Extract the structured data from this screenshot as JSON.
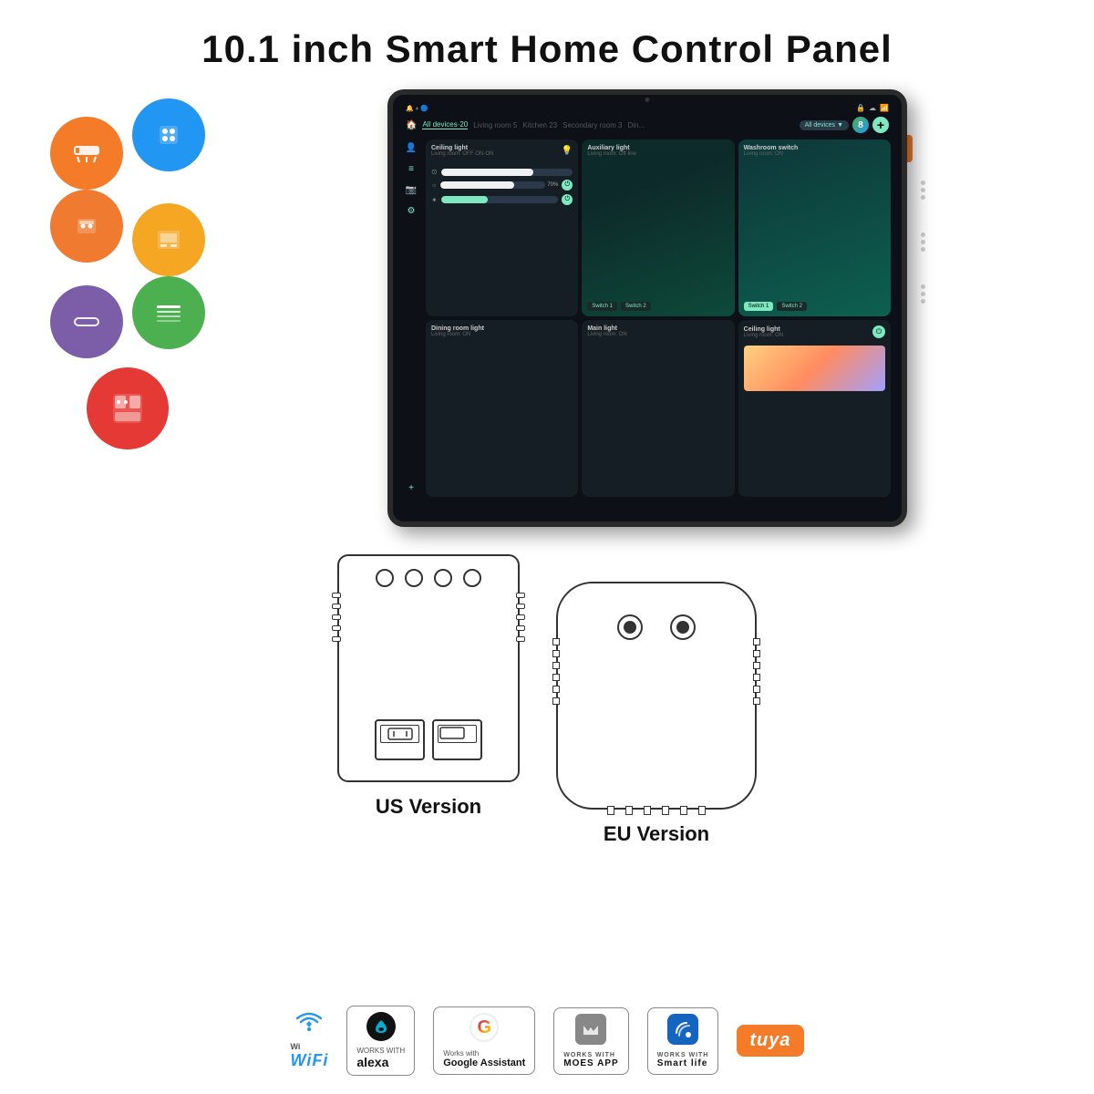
{
  "title": "10.1 inch Smart Home Control Panel",
  "icons": [
    {
      "id": "ac-icon",
      "color": "orange-ac",
      "symbol": "❄"
    },
    {
      "id": "switch-icon",
      "color": "blue-switch",
      "symbol": "⊞"
    },
    {
      "id": "oven-icon",
      "color": "orange-oven",
      "symbol": "▣"
    },
    {
      "id": "panel-icon",
      "color": "orange-panel",
      "symbol": "⊟"
    },
    {
      "id": "ac2-icon",
      "color": "purple-ac",
      "symbol": "▬"
    },
    {
      "id": "blind-icon",
      "color": "green-blind",
      "symbol": "☰"
    },
    {
      "id": "circuit-icon",
      "color": "red-circuit",
      "symbol": "⊡"
    }
  ],
  "tablet": {
    "navTabs": [
      "All devices·20",
      "Living room 5",
      "Kitchen 23",
      "Secondary room 3",
      "Din..."
    ],
    "filterLabel": "All devices",
    "cards": [
      {
        "title": "Ceiling light",
        "sub": "Living room: OFF·ON·ON",
        "type": "sliders"
      },
      {
        "title": "Auxiliary light",
        "sub": "Living room: Off·line",
        "type": "teal",
        "switches": [
          "Switch 1",
          "Switch 2"
        ]
      },
      {
        "title": "Washroom switch",
        "sub": "Living room: ON",
        "type": "teal-active",
        "switches": [
          "Switch 1",
          "Switch 2"
        ]
      },
      {
        "title": "Dining room light",
        "sub": "Living room: ON",
        "type": "dark"
      },
      {
        "title": "Main light",
        "sub": "Living room: ON",
        "type": "dark"
      },
      {
        "title": "Ceiling light",
        "sub": "Living room: ON",
        "type": "color",
        "hasPower": true
      }
    ]
  },
  "versions": [
    {
      "id": "us",
      "label": "US Version",
      "type": "us"
    },
    {
      "id": "eu",
      "label": "EU Version",
      "type": "eu"
    }
  ],
  "badges": [
    {
      "id": "wifi",
      "type": "wifi",
      "label": "WiFi"
    },
    {
      "id": "alexa",
      "type": "alexa",
      "worksWithLabel": "WORKS WITH",
      "label": "alexa"
    },
    {
      "id": "google",
      "type": "google",
      "worksWithLabel": "Works with",
      "label": "Google Assistant"
    },
    {
      "id": "moes",
      "type": "moes",
      "worksWithLabel": "WORKS WITH",
      "label": "MOES APP"
    },
    {
      "id": "smartlife",
      "type": "smartlife",
      "worksWithLabel": "WORKS WITH",
      "label": "Smart life"
    },
    {
      "id": "tuya",
      "type": "tuya",
      "label": "tuya"
    }
  ]
}
